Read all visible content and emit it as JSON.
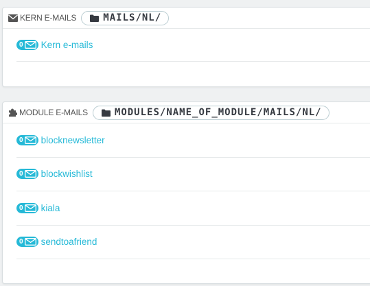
{
  "core_panel": {
    "title": "KERN E-MAILS",
    "path": "MAILS/NL/",
    "items": [
      {
        "count": "0",
        "label": "Kern e-mails"
      }
    ]
  },
  "module_panel": {
    "title": "MODULE E-MAILS",
    "path": "MODULES/NAME_OF_MODULE/MAILS/NL/",
    "items": [
      {
        "count": "0",
        "label": "blocknewsletter"
      },
      {
        "count": "0",
        "label": "blockwishlist"
      },
      {
        "count": "0",
        "label": "kiala"
      },
      {
        "count": "0",
        "label": "sendtoafriend"
      }
    ]
  },
  "colors": {
    "accent": "#25b9d7",
    "background": "#eff1f2",
    "heading_text": "#555555"
  },
  "icons": {
    "core_heading": "envelope-icon",
    "module_heading": "puzzle-icon",
    "path": "folder-icon",
    "badge": "envelope-outline-icon"
  }
}
